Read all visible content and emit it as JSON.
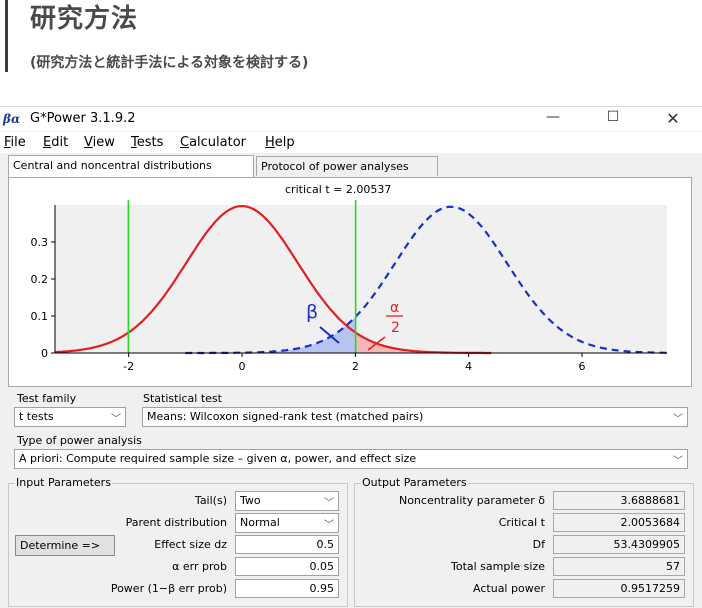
{
  "page": {
    "title": "研究方法",
    "subtitle": "(研究方法と統計手法による対象を検討する)"
  },
  "window": {
    "icon_text": "βα",
    "title": "G*Power 3.1.9.2",
    "minimize": "—",
    "maximize": "☐",
    "close": "✕"
  },
  "menu": [
    {
      "accel": "F",
      "rest": "ile"
    },
    {
      "accel": "E",
      "rest": "dit"
    },
    {
      "accel": "V",
      "rest": "iew"
    },
    {
      "accel": "T",
      "rest": "ests"
    },
    {
      "accel": "C",
      "rest": "alculator"
    },
    {
      "accel": "H",
      "rest": "elp"
    }
  ],
  "tabs": {
    "central": "Central and noncentral distributions",
    "protocol": "Protocol of power analyses"
  },
  "plot": {
    "critical_label": "critical t =  2.00537",
    "beta_label": "β",
    "alpha_num": "α",
    "alpha_den": "2",
    "colors": {
      "null_curve": "#e02020",
      "alt_curve": "#1a2ecc",
      "critical_line": "#22dd22",
      "beta_fill": "#b8c4f0",
      "alpha_fill": "#f4b8b8"
    }
  },
  "chart_data": {
    "type": "line",
    "series": [
      {
        "distribution": "central t",
        "df": 53.4309905,
        "noncentrality": 0,
        "color": "#e02020",
        "style": "solid"
      },
      {
        "distribution": "noncentral t",
        "df": 53.4309905,
        "noncentrality": 3.6888681,
        "color": "#1a2ecc",
        "style": "dashed"
      }
    ],
    "critical_values": [
      -2.00537,
      2.00537
    ],
    "x_ticks": [
      "-2",
      "0",
      "2",
      "4",
      "6"
    ],
    "y_ticks": [
      "0",
      "0.1",
      "0.2",
      "0.3"
    ],
    "xlim": [
      -3.3,
      7.5
    ],
    "ylim": [
      0,
      0.4
    ]
  },
  "test_family": {
    "label": "Test family",
    "value": "t tests"
  },
  "statistical_test": {
    "label": "Statistical test",
    "value": "Means: Wilcoxon signed-rank test (matched pairs)"
  },
  "power_analysis": {
    "label": "Type of power analysis",
    "value": "A priori: Compute required sample size – given α, power, and effect size"
  },
  "input": {
    "title": "Input Parameters",
    "tails_label": "Tail(s)",
    "tails_value": "Two",
    "parent_label": "Parent distribution",
    "parent_value": "Normal",
    "determine_button": "Determine =>",
    "effect_label": "Effect size dz",
    "effect_value": "0.5",
    "alpha_label": "α err prob",
    "alpha_value": "0.05",
    "power_label": "Power (1−β err prob)",
    "power_value": "0.95"
  },
  "output": {
    "title": "Output Parameters",
    "ncp_label": "Noncentrality parameter δ",
    "ncp_value": "3.6888681",
    "crit_label": "Critical t",
    "crit_value": "2.0053684",
    "df_label": "Df",
    "df_value": "53.4309905",
    "n_label": "Total sample size",
    "n_value": "57",
    "power_label": "Actual power",
    "power_value": "0.9517259"
  }
}
